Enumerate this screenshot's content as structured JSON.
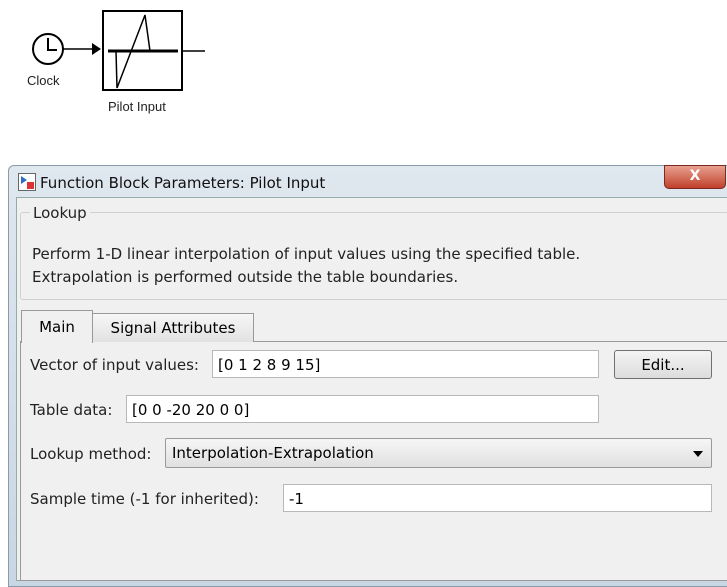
{
  "diagram": {
    "clock_label": "Clock",
    "block_label": "Pilot Input"
  },
  "dialog": {
    "title": "Function Block Parameters: Pilot Input",
    "close_label": "X",
    "group_title": "Lookup",
    "description": [
      "Perform 1-D linear interpolation of input values using the specified table.",
      "Extrapolation is performed outside the table boundaries."
    ],
    "tabs": [
      {
        "label": "Main",
        "active": true
      },
      {
        "label": "Signal Attributes",
        "active": false
      }
    ],
    "fields": {
      "input_values_label": "Vector of input values:",
      "input_values": "[0 1 2 8 9 15]",
      "edit_label": "Edit...",
      "table_data_label": "Table data:",
      "table_data": "[0 0 -20 20 0 0]",
      "lookup_method_label": "Lookup method:",
      "lookup_method": "Interpolation-Extrapolation",
      "sample_time_label": "Sample time (-1 for inherited):",
      "sample_time": "-1"
    }
  }
}
